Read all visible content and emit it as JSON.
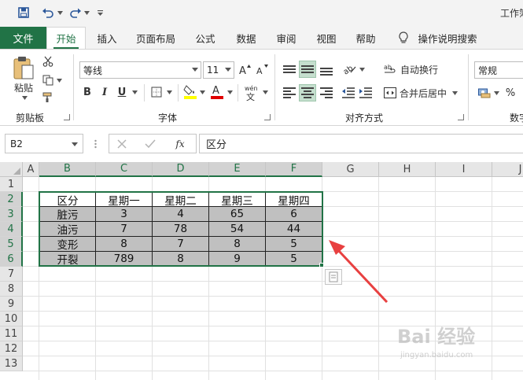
{
  "window": {
    "title": "工作簿"
  },
  "qat": {
    "save_icon": "save-icon",
    "undo_icon": "undo-icon",
    "redo_icon": "redo-icon",
    "customize_icon": "customize-qat-icon"
  },
  "tabs": {
    "file": "文件",
    "items": [
      {
        "label": "开始",
        "active": true
      },
      {
        "label": "插入"
      },
      {
        "label": "页面布局"
      },
      {
        "label": "公式"
      },
      {
        "label": "数据"
      },
      {
        "label": "审阅"
      },
      {
        "label": "视图"
      },
      {
        "label": "帮助"
      }
    ],
    "tell_me": "操作说明搜索"
  },
  "ribbon": {
    "clipboard": {
      "paste": "粘贴",
      "label": "剪贴板"
    },
    "font": {
      "name": "等线",
      "size": "11",
      "bold": "B",
      "italic": "I",
      "underline": "U",
      "font_color_letter": "A",
      "phonetic_top": "wén",
      "phonetic_bottom": "文",
      "label": "字体",
      "highlight_color": "#ffff00",
      "font_color": "#e00000"
    },
    "alignment": {
      "wrap_text": "自动换行",
      "merge_center": "合并后居中",
      "label": "对齐方式"
    },
    "number": {
      "format": "常规",
      "percent": "%",
      "label": "数字"
    }
  },
  "formula_bar": {
    "name_box": "B2",
    "fx": "fx",
    "content": "区分"
  },
  "grid": {
    "columns": [
      "A",
      "B",
      "C",
      "D",
      "E",
      "F",
      "G",
      "H",
      "I",
      "J"
    ],
    "rows": [
      "1",
      "2",
      "3",
      "4",
      "5",
      "6",
      "7",
      "8",
      "9",
      "10",
      "11",
      "12",
      "13"
    ],
    "active_columns": [
      "B",
      "C",
      "D",
      "E",
      "F"
    ],
    "active_rows": [
      "2",
      "3",
      "4",
      "5",
      "6"
    ],
    "table": {
      "header": [
        "区分",
        "星期一",
        "星期二",
        "星期三",
        "星期四"
      ],
      "rows": [
        [
          "脏污",
          "3",
          "4",
          "65",
          "6"
        ],
        [
          "油污",
          "7",
          "78",
          "54",
          "44"
        ],
        [
          "变形",
          "8",
          "7",
          "8",
          "5"
        ],
        [
          "开裂",
          "789",
          "8",
          "9",
          "5"
        ]
      ]
    },
    "table_fill": "#c0c0c0",
    "annotation_arrow_color": "#e84040"
  },
  "watermark": {
    "logo": "Bai 经验",
    "url": "jingyan.baidu.com"
  },
  "colors": {
    "accent": "#217346"
  }
}
